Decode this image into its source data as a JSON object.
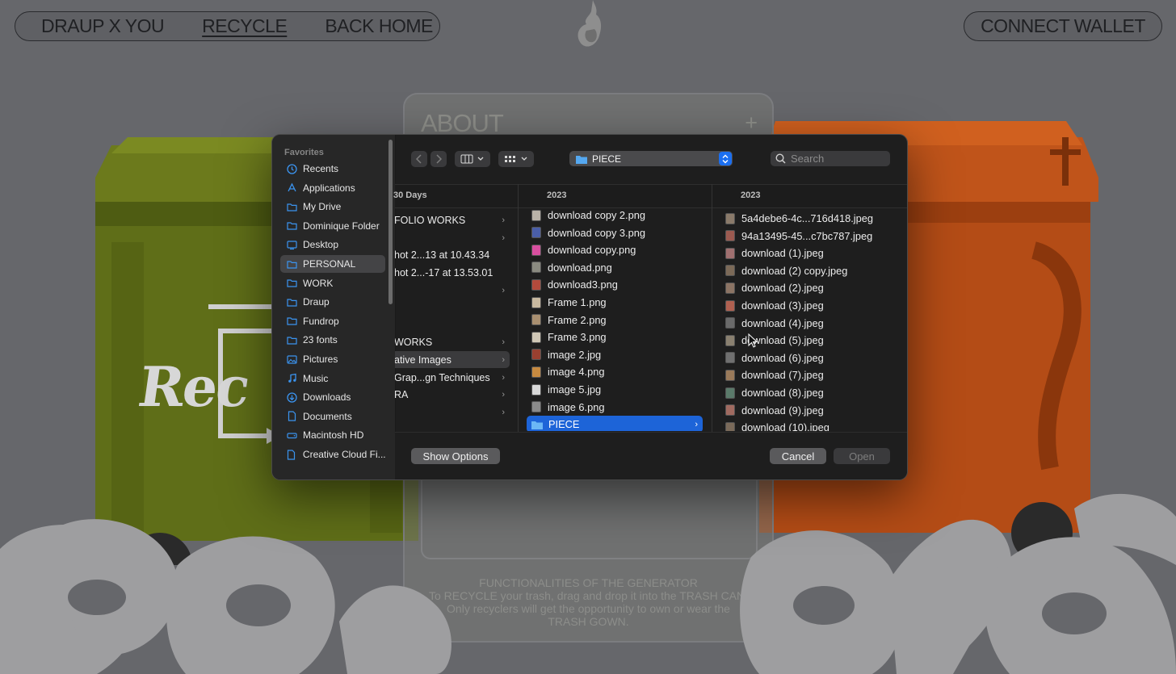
{
  "nav": {
    "links": [
      "DRAUP X YOU",
      "RECYCLE",
      "BACK HOME"
    ],
    "active": "RECYCLE",
    "connect_wallet": "CONNECT WALLET"
  },
  "bin_sticker": "Rec",
  "about": {
    "title": "ABOUT",
    "plus": "+",
    "heading": "FUNCTIONALITIES OF THE GENERATOR",
    "line1": "To RECYCLE your trash, drag and drop it into the TRASH CAN.",
    "line2": "Only recyclers will get the opportunity to own or wear the",
    "line3": "TRASH GOWN."
  },
  "dialog": {
    "sidebar": {
      "section": "Favorites",
      "items": [
        {
          "label": "Recents",
          "icon": "clock-icon"
        },
        {
          "label": "Applications",
          "icon": "applications-icon"
        },
        {
          "label": "My Drive",
          "icon": "folder-icon"
        },
        {
          "label": "Dominique Folder",
          "icon": "folder-icon"
        },
        {
          "label": "Desktop",
          "icon": "desktop-icon"
        },
        {
          "label": "PERSONAL",
          "icon": "folder-icon",
          "selected": true
        },
        {
          "label": "WORK",
          "icon": "folder-icon"
        },
        {
          "label": "Draup",
          "icon": "folder-icon"
        },
        {
          "label": "Fundrop",
          "icon": "folder-icon"
        },
        {
          "label": "23 fonts",
          "icon": "folder-icon"
        },
        {
          "label": "Pictures",
          "icon": "pictures-icon"
        },
        {
          "label": "Music",
          "icon": "music-icon"
        },
        {
          "label": "Downloads",
          "icon": "downloads-icon"
        },
        {
          "label": "Documents",
          "icon": "document-icon"
        },
        {
          "label": "Macintosh HD",
          "icon": "disk-icon"
        },
        {
          "label": "Creative Cloud Fi...",
          "icon": "document-icon"
        }
      ]
    },
    "toolbar": {
      "path": "PIECE",
      "search_placeholder": "Search"
    },
    "columns": {
      "a_header": "30 Days",
      "b_header": "2023",
      "c_header": "2023",
      "a_rows": [
        {
          "text": "FOLIO WORKS",
          "chev": true
        },
        {
          "text": "",
          "chev": true
        },
        {
          "text": "hot 2...13 at 10.43.34",
          "chev": false
        },
        {
          "text": "hot 2...-17 at 13.53.01",
          "chev": false
        },
        {
          "text": "",
          "chev": true
        },
        {
          "text": "",
          "chev": false
        },
        {
          "text": "",
          "chev": false
        },
        {
          "text": "WORKS",
          "chev": true
        },
        {
          "text": "ative Images",
          "chev": true,
          "selected": true
        },
        {
          "text": "Grap...gn Techniques",
          "chev": true
        },
        {
          "text": "RA",
          "chev": true
        },
        {
          "text": "",
          "chev": true
        }
      ],
      "b_rows": [
        {
          "name": "download copy 2.png",
          "thumb": "#b9b2a8"
        },
        {
          "name": "download copy 3.png",
          "thumb": "#4a5ea8"
        },
        {
          "name": "download copy.png",
          "thumb": "#d94fa0"
        },
        {
          "name": "download.png",
          "thumb": "#8a8a80"
        },
        {
          "name": "download3.png",
          "thumb": "#b44a3c"
        },
        {
          "name": "Frame 1.png",
          "thumb": "#c9b9a0"
        },
        {
          "name": "Frame 2.png",
          "thumb": "#a98f70"
        },
        {
          "name": "Frame 3.png",
          "thumb": "#cfc7b6"
        },
        {
          "name": "image 2.jpg",
          "thumb": "#9a4030"
        },
        {
          "name": "image 4.png",
          "thumb": "#c78a40"
        },
        {
          "name": "image 5.jpg",
          "thumb": "#d8d8d8"
        },
        {
          "name": "image 6.png",
          "thumb": "#8a8a8a"
        },
        {
          "name": "PIECE",
          "folder": true,
          "selected": true
        }
      ],
      "c_rows": [
        {
          "name": "5a4debe6-4c...716d418.jpeg",
          "thumb": "#8a7a6a"
        },
        {
          "name": "94a13495-45...c7bc787.jpeg",
          "thumb": "#9c5a50"
        },
        {
          "name": "download (1).jpeg",
          "thumb": "#a07070"
        },
        {
          "name": "download (2) copy.jpeg",
          "thumb": "#7c6a58"
        },
        {
          "name": "download (2).jpeg",
          "thumb": "#8c7464"
        },
        {
          "name": "download (3).jpeg",
          "thumb": "#b06050"
        },
        {
          "name": "download (4).jpeg",
          "thumb": "#6a6a6a"
        },
        {
          "name": "download (5).jpeg",
          "thumb": "#8a8070"
        },
        {
          "name": "download (6).jpeg",
          "thumb": "#707070"
        },
        {
          "name": "download (7).jpeg",
          "thumb": "#9a7a5a"
        },
        {
          "name": "download (8).jpeg",
          "thumb": "#5a7a6a"
        },
        {
          "name": "download (9).jpeg",
          "thumb": "#a06a60"
        },
        {
          "name": "download (10).jpeg",
          "thumb": "#7a6a5a"
        }
      ]
    },
    "buttons": {
      "show_options": "Show Options",
      "cancel": "Cancel",
      "open": "Open"
    }
  }
}
